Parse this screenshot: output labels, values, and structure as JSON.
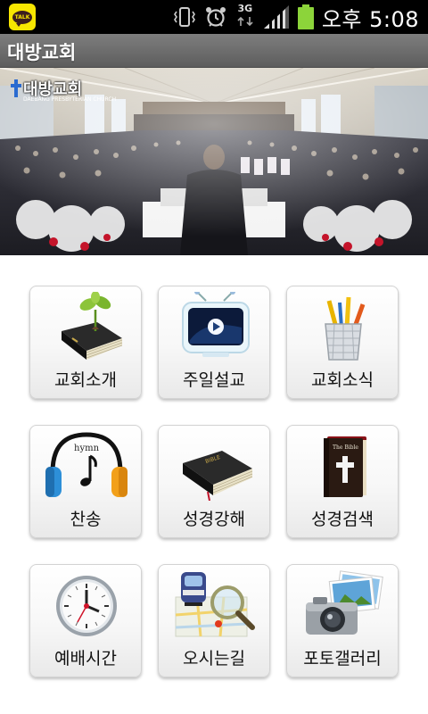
{
  "status_bar": {
    "app_notification": "TALK",
    "network": "3G",
    "time": "오후 5:08",
    "battery_color": "#8cd43a"
  },
  "title_bar": {
    "title": "대방교회"
  },
  "banner": {
    "logo_text": "대방교회",
    "logo_subtext": "DAEBANG PRESBYTERIAN CHURCH"
  },
  "menu": {
    "items": [
      {
        "label": "교회소개",
        "icon": "bible-sprout-icon"
      },
      {
        "label": "주일설교",
        "icon": "tv-play-icon"
      },
      {
        "label": "교회소식",
        "icon": "pencil-cup-icon"
      },
      {
        "label": "찬송",
        "icon": "headphones-hymn-icon"
      },
      {
        "label": "성경강해",
        "icon": "bible-book-icon"
      },
      {
        "label": "성경검색",
        "icon": "holy-bible-icon"
      },
      {
        "label": "예배시간",
        "icon": "clock-icon"
      },
      {
        "label": "오시는길",
        "icon": "map-magnifier-icon"
      },
      {
        "label": "포토갤러리",
        "icon": "camera-photos-icon"
      }
    ]
  },
  "book_label": "BIBLE",
  "holy_bible_label": "The Bible",
  "hymn_label": "hymn"
}
